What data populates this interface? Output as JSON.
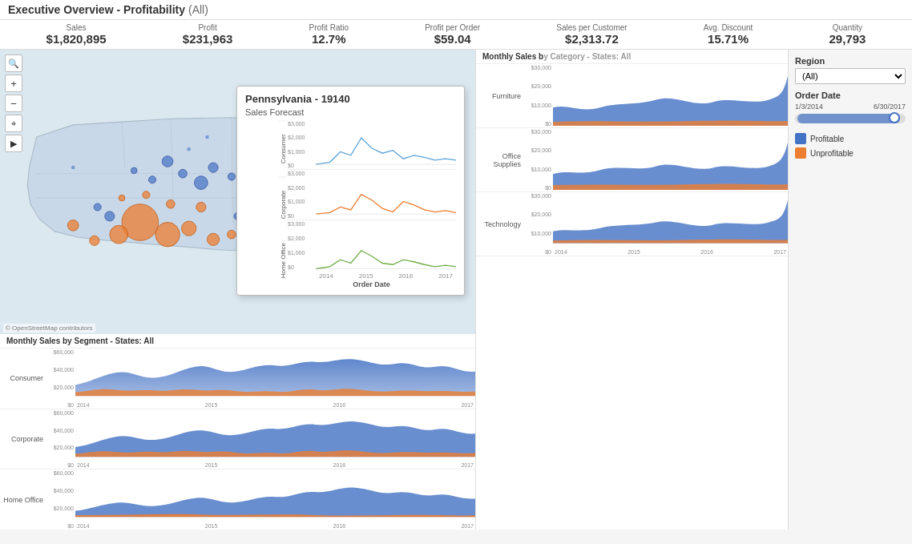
{
  "header": {
    "title": "Executive Overview - Profitability",
    "filter": "(All)"
  },
  "metrics": [
    {
      "label": "Sales",
      "value": "$1,820,895"
    },
    {
      "label": "Profit",
      "value": "$231,963"
    },
    {
      "label": "Profit Ratio",
      "value": "12.7%"
    },
    {
      "label": "Profit per Order",
      "value": "$59.04"
    },
    {
      "label": "Sales per Customer",
      "value": "$2,313.72"
    },
    {
      "label": "Avg. Discount",
      "value": "15.71%"
    },
    {
      "label": "Quantity",
      "value": "29,793"
    }
  ],
  "sidebar": {
    "region_label": "Region",
    "region_value": "(All)",
    "order_date_label": "Order Date",
    "date_start": "1/3/2014",
    "date_end": "6/30/2017",
    "legend": [
      {
        "label": "Profitable",
        "color": "#4472c4"
      },
      {
        "label": "Unprofitable",
        "color": "#ed7d31"
      }
    ]
  },
  "map": {
    "attribution": "© OpenStreetMap contributors"
  },
  "left_charts": {
    "title": "Monthly Sales by Segment - States: All",
    "segments": [
      "Consumer",
      "Corporate",
      "Home Office"
    ],
    "y_labels": [
      "$60,000",
      "$40,000",
      "$20,000",
      "$0"
    ],
    "x_labels": [
      "2014",
      "2015",
      "2016",
      "2017"
    ]
  },
  "right_charts": {
    "title": "Monthly Sales b",
    "categories": [
      "Furniture",
      "Office\nSupplies",
      "Technology"
    ],
    "y_labels": [
      "$30,",
      "$20,",
      "$10,",
      "$0"
    ],
    "x_labels": [
      "2014",
      "2015",
      "2016",
      "2017"
    ]
  },
  "tooltip": {
    "title": "Pennsylvania - 19140",
    "subtitle": "Sales Forecast",
    "series": [
      {
        "label": "Consumer",
        "color": "#5ba3d9"
      },
      {
        "label": "Corporate",
        "color": "#ed7d31"
      },
      {
        "label": "Home Office",
        "color": "#70ad47"
      }
    ],
    "y_labels": [
      "$3,000",
      "$2,000",
      "$1,000",
      "$0"
    ],
    "x_labels": [
      "2014",
      "2015",
      "2016",
      "2017"
    ],
    "x_axis_label": "Order Date"
  },
  "map_controls": {
    "search": "🔍",
    "zoom_in": "+",
    "zoom_out": "−",
    "pin": "⊕",
    "play": "▶"
  }
}
